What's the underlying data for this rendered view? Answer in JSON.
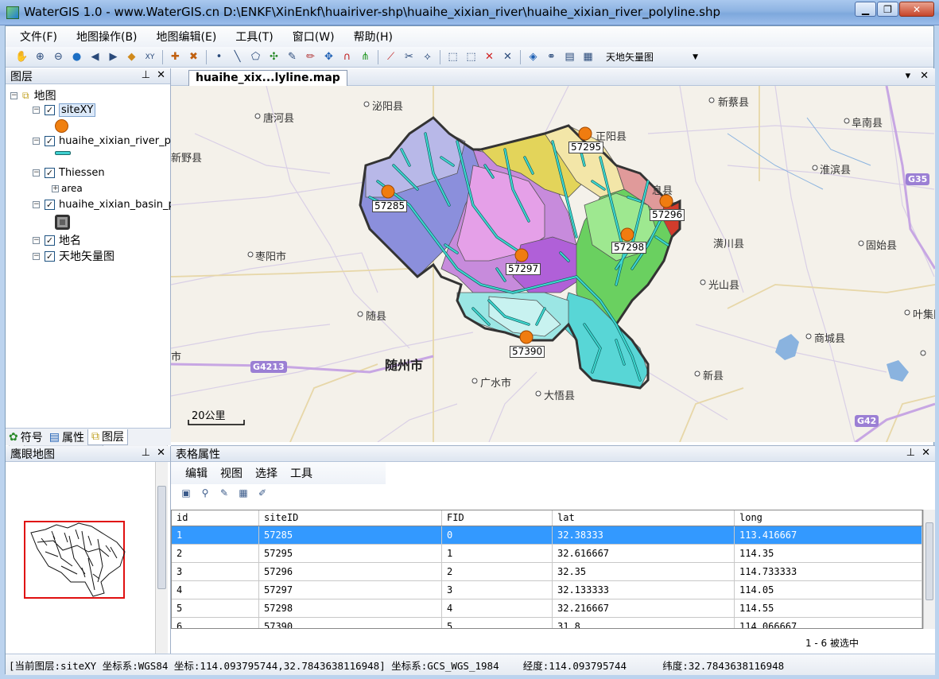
{
  "window": {
    "title": "WaterGIS 1.0 - www.WaterGIS.cn D:\\ENKF\\XinEnkf\\huairiver-shp\\huaihe_xixian_river\\huaihe_xixian_river_polyline.shp",
    "min": "▁",
    "max": "❐",
    "close": "✕"
  },
  "menu": [
    "文件(F)",
    "地图操作(B)",
    "地图编辑(E)",
    "工具(T)",
    "窗口(W)",
    "帮助(H)"
  ],
  "toolbar": {
    "layer_select": "天地矢量图"
  },
  "layers_panel": {
    "title": "图层",
    "root": "地图",
    "layers": [
      {
        "name": "siteXY"
      },
      {
        "name": "huaihe_xixian_river_pol"
      },
      {
        "name": "Thiessen",
        "sub": "area"
      },
      {
        "name": "huaihe_xixian_basin_po"
      },
      {
        "name": "地名"
      },
      {
        "name": "天地矢量图"
      }
    ],
    "tabs": [
      "符号",
      "属性",
      "图层"
    ]
  },
  "overview_panel": {
    "title": "鹰眼地图"
  },
  "map": {
    "tab": "huaihe_xix...lyline.map",
    "scale": "20公里",
    "places": [
      {
        "name": "泌阳县"
      },
      {
        "name": "唐河县"
      },
      {
        "name": "新蔡县"
      },
      {
        "name": "阜南县"
      },
      {
        "name": "正阳县"
      },
      {
        "name": "淮滨县"
      },
      {
        "name": "息县"
      },
      {
        "name": "潢川县"
      },
      {
        "name": "固始县"
      },
      {
        "name": "枣阳市"
      },
      {
        "name": "光山县"
      },
      {
        "name": "随县"
      },
      {
        "name": "随州市"
      },
      {
        "name": "广水市"
      },
      {
        "name": "大悟县"
      },
      {
        "name": "新县"
      },
      {
        "name": "商城县"
      },
      {
        "name": "叶集区"
      },
      {
        "name": "新野县"
      },
      {
        "name": "市"
      }
    ],
    "shields": [
      "G4213",
      "G35",
      "G42"
    ],
    "sites": [
      "57285",
      "57295",
      "57296",
      "57297",
      "57298",
      "57390"
    ]
  },
  "table_panel": {
    "title": "表格属性",
    "menu": [
      "编辑",
      "视图",
      "选择",
      "工具"
    ],
    "columns": [
      "id",
      "siteID",
      "FID",
      "lat",
      "long"
    ],
    "rows": [
      [
        "1",
        "57285",
        "0",
        "32.38333",
        "113.416667"
      ],
      [
        "2",
        "57295",
        "1",
        "32.616667",
        "114.35"
      ],
      [
        "3",
        "57296",
        "2",
        "32.35",
        "114.733333"
      ],
      [
        "4",
        "57297",
        "3",
        "32.133333",
        "114.05"
      ],
      [
        "5",
        "57298",
        "4",
        "32.216667",
        "114.55"
      ],
      [
        "6",
        "57390",
        "5",
        "31.8",
        "114.066667"
      ]
    ],
    "selection": "1 - 6 被选中"
  },
  "status": "[当前图层:siteXY 坐标系:WGS84 坐标:114.093795744,32.7843638116948] 坐标系:GCS_WGS_1984    经度:114.093795744      纬度:32.7843638116948"
}
